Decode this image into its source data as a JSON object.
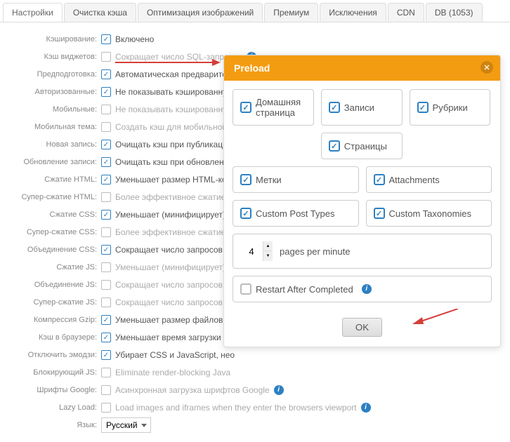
{
  "tabs": [
    "Настройки",
    "Очистка кэша",
    "Оптимизация изображений",
    "Премиум",
    "Исключения",
    "CDN",
    "DB (1053)"
  ],
  "activeTab": 0,
  "settings": [
    {
      "label": "Кэширование:",
      "checked": true,
      "desc": "Включено",
      "muted": false,
      "info": false
    },
    {
      "label": "Кэш виджетов:",
      "checked": false,
      "desc": "Сокращает число SQL-запросов",
      "muted": true,
      "info": true
    },
    {
      "label": "Предподготовка:",
      "checked": true,
      "desc": "Автоматическая предварительн",
      "muted": false,
      "info": false
    },
    {
      "label": "Авторизованные:",
      "checked": true,
      "desc": "Не показывать кэшированну",
      "muted": false,
      "info": false
    },
    {
      "label": "Мобильные:",
      "checked": false,
      "desc": "Не показывать кэшированну",
      "muted": true,
      "info": false
    },
    {
      "label": "Мобильная тема:",
      "checked": false,
      "desc": "Создать кэш для мобильной",
      "muted": true,
      "info": false
    },
    {
      "label": "Новая запись:",
      "checked": true,
      "desc": "Очищать кэш при публикаци",
      "muted": false,
      "info": false
    },
    {
      "label": "Обновление записи:",
      "checked": true,
      "desc": "Очищать кэш при обновлени",
      "muted": false,
      "info": false
    },
    {
      "label": "Сжатие HTML:",
      "checked": true,
      "desc": "Уменьшает размер HTML-код",
      "muted": false,
      "info": false
    },
    {
      "label": "Супер-сжатие HTML:",
      "checked": false,
      "desc": "Более эффективное сжатие H",
      "muted": true,
      "info": false
    },
    {
      "label": "Сжатие CSS:",
      "checked": true,
      "desc": "Уменьшает (минифицирует) с",
      "muted": false,
      "info": false
    },
    {
      "label": "Супер-сжатие CSS:",
      "checked": false,
      "desc": "Более эффективное сжатие C",
      "muted": true,
      "info": false
    },
    {
      "label": "Объединение CSS:",
      "checked": true,
      "desc": "Сокращает число запросов к",
      "muted": false,
      "info": false
    },
    {
      "label": "Сжатие JS:",
      "checked": false,
      "desc": "Уменьшает (минифицирует) с",
      "muted": true,
      "info": false
    },
    {
      "label": "Объединение JS:",
      "checked": false,
      "desc": "Сокращает число запросов к",
      "muted": true,
      "info": false
    },
    {
      "label": "Супер-сжатие JS:",
      "checked": false,
      "desc": "Сокращает число запросов, о",
      "muted": true,
      "info": false
    },
    {
      "label": "Компрессия Gzip:",
      "checked": true,
      "desc": "Уменьшает размер файлов, о",
      "muted": false,
      "info": false
    },
    {
      "label": "Кэш в браузере:",
      "checked": true,
      "desc": "Уменьшает время загрузки дл",
      "muted": false,
      "info": false
    },
    {
      "label": "Отключить эмодзи:",
      "checked": true,
      "desc": "Убирает CSS и JavaScript, нео",
      "muted": false,
      "info": false
    },
    {
      "label": "Блокирующий JS:",
      "checked": false,
      "desc": "Eliminate render-blocking Java",
      "muted": true,
      "info": false
    },
    {
      "label": "Шрифты Google:",
      "checked": false,
      "desc": "Асинхронная загрузка шрифтов Google",
      "muted": true,
      "info": true
    },
    {
      "label": "Lazy Load:",
      "checked": false,
      "desc": "Load images and iframes when they enter the browsers viewport",
      "muted": true,
      "info": true
    }
  ],
  "langLabel": "Язык:",
  "langValue": "Русский",
  "modal": {
    "title": "Preload",
    "opts": [
      {
        "label": "Домашняя страница",
        "checked": true
      },
      {
        "label": "Записи",
        "checked": true
      },
      {
        "label": "Рубрики",
        "checked": true
      },
      {
        "label": "Страницы",
        "checked": true
      },
      {
        "label": "Метки",
        "checked": true
      },
      {
        "label": "Attachments",
        "checked": true
      },
      {
        "label": "Custom Post Types",
        "checked": true
      },
      {
        "label": "Custom Taxonomies",
        "checked": true
      }
    ],
    "ppmValue": "4",
    "ppmLabel": "pages per minute",
    "restartLabel": "Restart After Completed",
    "ok": "OK"
  }
}
